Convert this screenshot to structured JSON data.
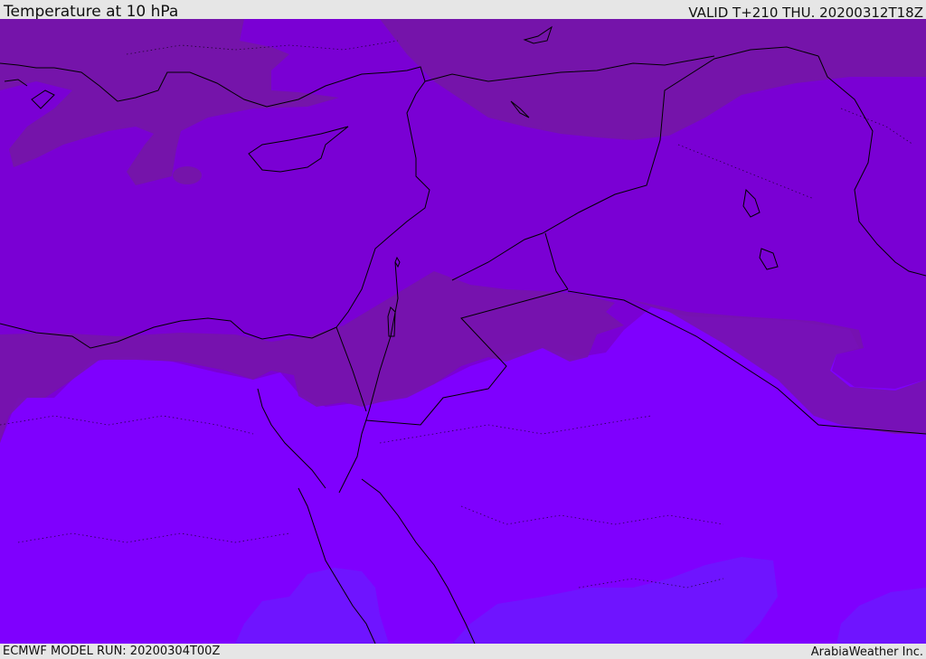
{
  "header": {
    "title": "Temperature at 10 hPa",
    "valid_time": "VALID T+210 THU. 20200312T18Z"
  },
  "footer": {
    "model_run": "ECMWF MODEL RUN: 20200304T00Z",
    "credit": "ArabiaWeather Inc."
  },
  "map": {
    "field": "Temperature",
    "level_hpa": 10,
    "colors": {
      "band_coldest": "#7514aa",
      "band_cold": "#7a00d4",
      "band_mid": "#7f00fe",
      "band_warm": "#6f14ff",
      "coastline": "#000000",
      "border": "#000000"
    }
  }
}
